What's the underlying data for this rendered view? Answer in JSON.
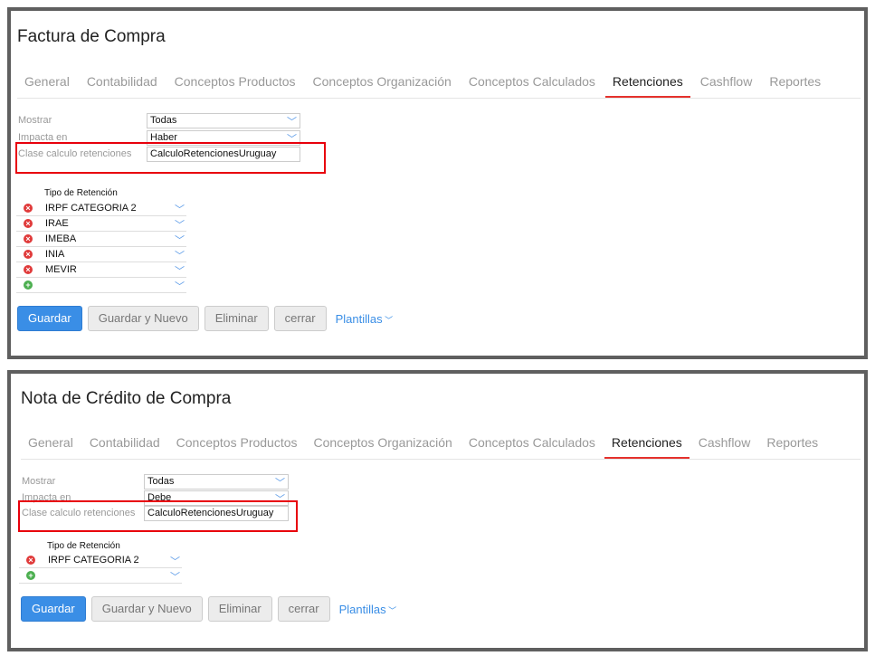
{
  "panels": [
    {
      "title": "Factura de Compra",
      "tabs": [
        "General",
        "Contabilidad",
        "Conceptos Productos",
        "Conceptos Organización",
        "Conceptos Calculados",
        "Retenciones",
        "Cashflow",
        "Reportes"
      ],
      "active_tab": 5,
      "fields": {
        "mostrar_label": "Mostrar",
        "mostrar_value": "Todas",
        "impacta_label": "Impacta en",
        "impacta_value": "Haber",
        "clase_label": "Clase calculo retenciones",
        "clase_value": "CalculoRetencionesUruguay"
      },
      "table_header": "Tipo de Retención",
      "rows": [
        "IRPF CATEGORIA 2",
        "IRAE",
        "IMEBA",
        "INIA",
        "MEVIR"
      ],
      "buttons": {
        "save": "Guardar",
        "save_new": "Guardar y Nuevo",
        "delete": "Eliminar",
        "close": "cerrar",
        "templates": "Plantillas"
      }
    },
    {
      "title": "Nota de Crédito de Compra",
      "tabs": [
        "General",
        "Contabilidad",
        "Conceptos Productos",
        "Conceptos Organización",
        "Conceptos Calculados",
        "Retenciones",
        "Cashflow",
        "Reportes"
      ],
      "active_tab": 5,
      "fields": {
        "mostrar_label": "Mostrar",
        "mostrar_value": "Todas",
        "impacta_label": "Impacta en",
        "impacta_value": "Debe",
        "clase_label": "Clase calculo retenciones",
        "clase_value": "CalculoRetencionesUruguay"
      },
      "table_header": "Tipo de Retención",
      "rows": [
        "IRPF CATEGORIA 2"
      ],
      "buttons": {
        "save": "Guardar",
        "save_new": "Guardar y Nuevo",
        "delete": "Eliminar",
        "close": "cerrar",
        "templates": "Plantillas"
      }
    }
  ],
  "colors": {
    "accent": "#3a8ee6",
    "highlight": "#e8000c",
    "remove": "#e03a3a",
    "add": "#4caf50"
  }
}
